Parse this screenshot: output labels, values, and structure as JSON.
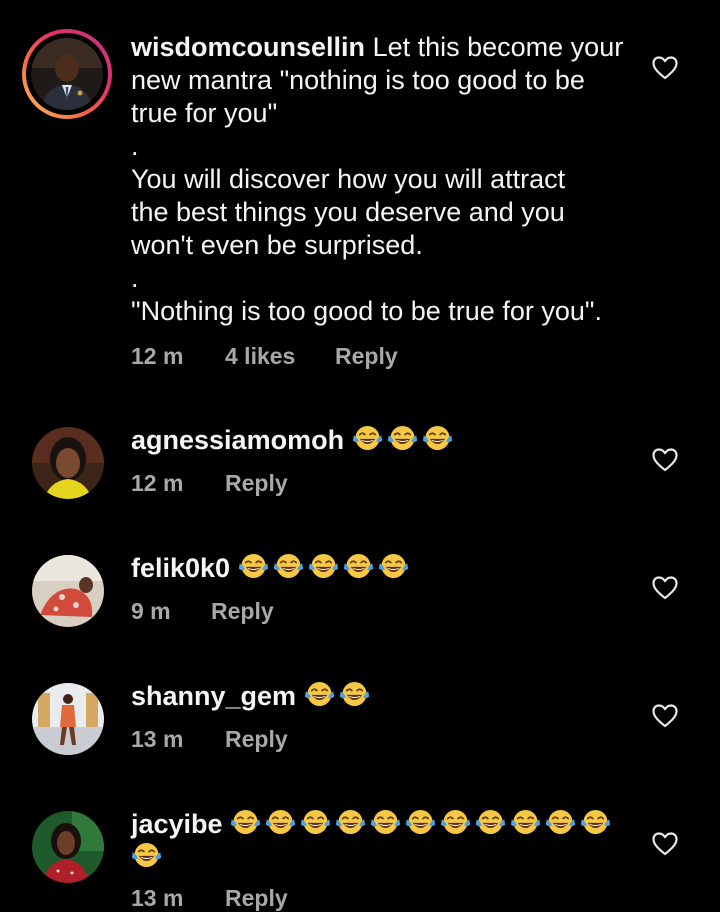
{
  "comments": [
    {
      "username": "wisdomcounsellin",
      "text_lines": [
        "Let this become your",
        "new mantra \"nothing is too good to be",
        "true for you\"",
        ".",
        "You will discover how you will attract",
        "the best things you deserve and you",
        "won't even be surprised.",
        ".",
        "\"Nothing is too good to be true for you\"."
      ],
      "time": "12 m",
      "likes": "4 likes",
      "reply": "Reply",
      "has_story_ring": true
    },
    {
      "username": "agnessiamomoh",
      "emoji_count": 3,
      "time": "12 m",
      "reply": "Reply"
    },
    {
      "username": "felik0k0",
      "emoji_count": 5,
      "time": "9 m",
      "reply": "Reply"
    },
    {
      "username": "shanny_gem",
      "emoji_count": 2,
      "time": "13 m",
      "reply": "Reply"
    },
    {
      "username": "jacyibe",
      "emoji_count": 12,
      "time": "13 m",
      "reply": "Reply"
    }
  ],
  "emoji_name": "face-with-tears-of-joy",
  "colors": {
    "background": "#000000",
    "text": "#f5f5f5",
    "meta": "#a8a8a8",
    "emoji_face": "#f7c845",
    "emoji_tear": "#4aa3e0"
  }
}
